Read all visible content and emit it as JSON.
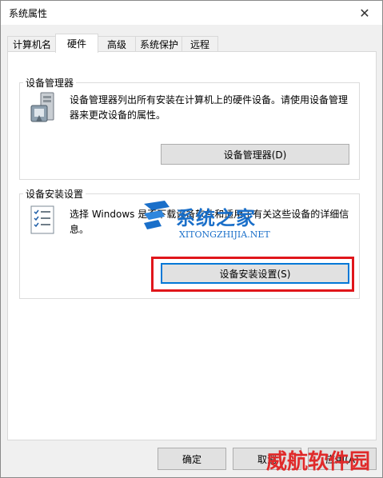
{
  "window": {
    "title": "系统属性"
  },
  "tabs": [
    {
      "label": "计算机名"
    },
    {
      "label": "硬件"
    },
    {
      "label": "高级"
    },
    {
      "label": "系统保护"
    },
    {
      "label": "远程"
    }
  ],
  "device_manager": {
    "group_label": "设备管理器",
    "description": "设备管理器列出所有安装在计算机上的硬件设备。请使用设备管理器来更改设备的属性。",
    "button_label": "设备管理器(D)"
  },
  "device_install": {
    "group_label": "设备安装设置",
    "description": "选择 Windows 是否下载设备软件和适用于有关这些设备的详细信息。",
    "button_label": "设备安装设置(S)"
  },
  "footer": {
    "ok_label": "确定",
    "cancel_label": "取消",
    "apply_label": "应用(A)"
  },
  "watermarks": {
    "site_cn": "系统之家",
    "site_en": "XITONGZHIJIA.NET",
    "corner": "威航软件园"
  },
  "colors": {
    "highlight": "#e0161b",
    "watermark_blue": "#1a6fc9",
    "corner_red": "#e02a2a"
  }
}
